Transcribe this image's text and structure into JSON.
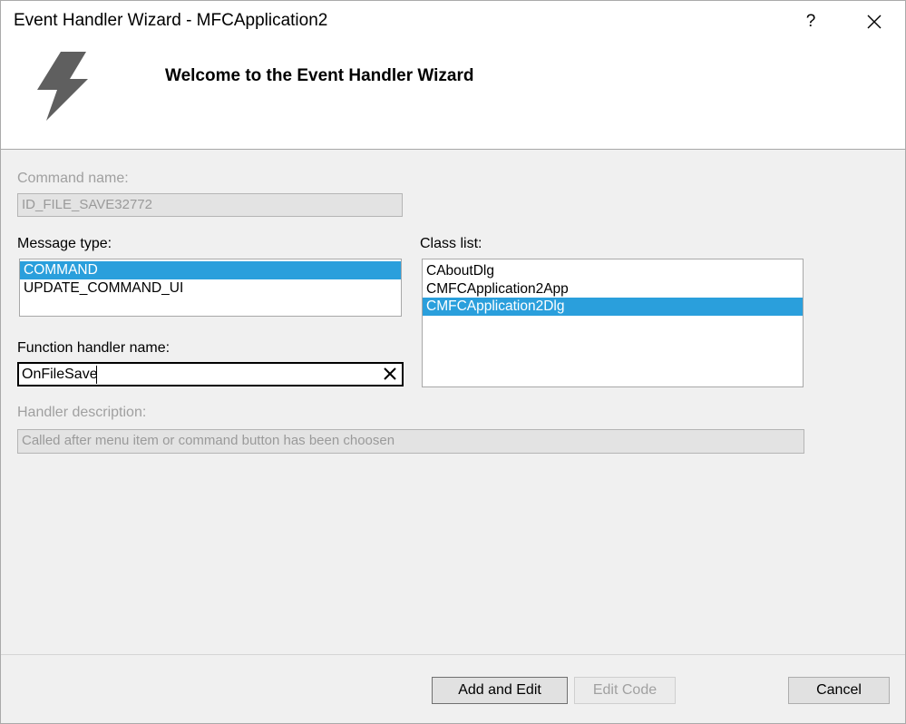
{
  "window": {
    "title": "Event Handler Wizard - MFCApplication2",
    "help_label": "?"
  },
  "header": {
    "welcome_text": "Welcome to the Event Handler Wizard",
    "icon": "lightning-bolt-icon"
  },
  "command_name": {
    "label": "Command name:",
    "value": "ID_FILE_SAVE32772",
    "enabled": false
  },
  "message_type": {
    "label": "Message type:",
    "items": [
      "COMMAND",
      "UPDATE_COMMAND_UI"
    ],
    "selected_index": 0
  },
  "class_list": {
    "label": "Class list:",
    "items": [
      "CAboutDlg",
      "CMFCApplication2App",
      "CMFCApplication2Dlg"
    ],
    "selected_index": 2
  },
  "function_handler": {
    "label": "Function handler name:",
    "value": "OnFileSave"
  },
  "handler_description": {
    "label": "Handler description:",
    "value": "Called after menu item or command button has been choosen",
    "enabled": false
  },
  "buttons": {
    "add_edit": "Add and Edit",
    "edit_code": "Edit Code",
    "cancel": "Cancel"
  },
  "colors": {
    "selection": "#2a9fdc",
    "header_bg": "#ffffff",
    "dialog_bg": "#f0f0f0"
  }
}
